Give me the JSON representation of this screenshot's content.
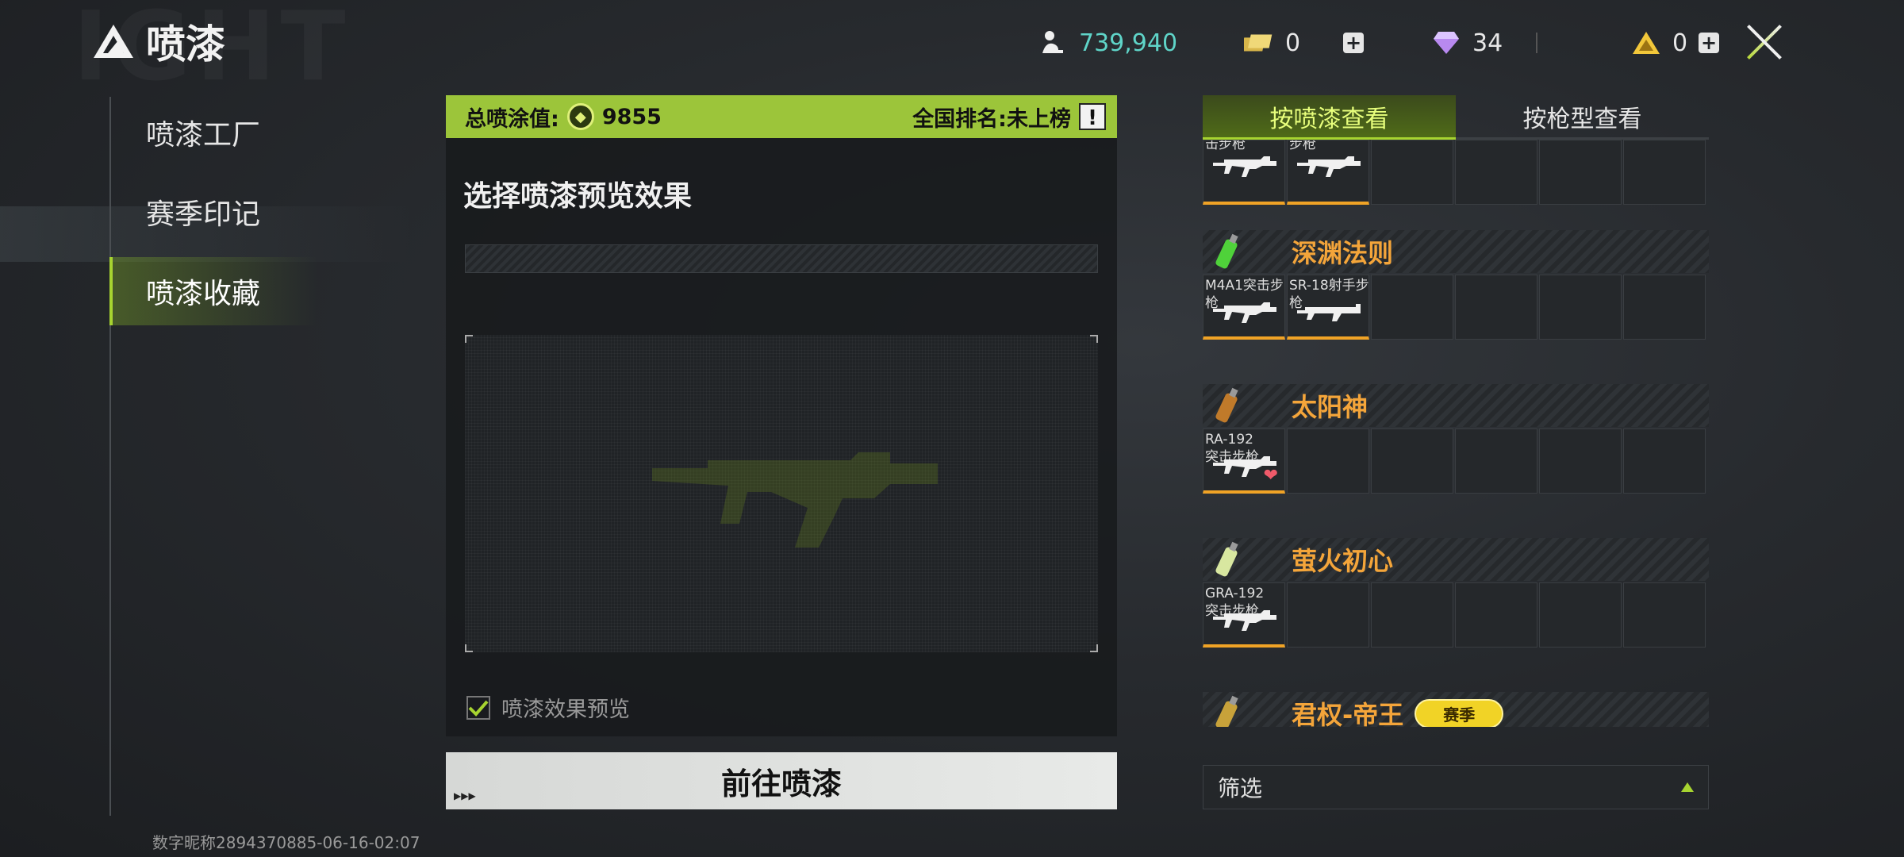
{
  "header": {
    "title": "喷漆",
    "watermark": "IGHT",
    "coins": "739,940",
    "tickets": "0",
    "diamonds": "34",
    "tokens": "0",
    "plus": "+"
  },
  "nav": {
    "items": [
      {
        "label": "喷漆工厂"
      },
      {
        "label": "赛季印记"
      },
      {
        "label": "喷漆收藏"
      }
    ],
    "active_index": 2
  },
  "center": {
    "score_label": "总喷涂值:",
    "score_value": "9855",
    "rank_label": "全国排名:未上榜",
    "info_glyph": "!",
    "preview_title": "选择喷漆预览效果",
    "checkbox_label": "喷漆效果预览",
    "checkbox_checked": true,
    "goto_button": "前往喷漆"
  },
  "right": {
    "tabs": [
      {
        "label": "按喷漆查看",
        "active": true
      },
      {
        "label": "按枪型查看",
        "active": false
      }
    ],
    "top_row_cells": [
      "击步枪",
      "步枪"
    ],
    "groups": [
      {
        "name": "深渊法则",
        "cells": [
          "M4A1突击步枪",
          "SR-18射手步枪"
        ],
        "can_color": "#4fd23a"
      },
      {
        "name": "太阳神",
        "cells": [
          "RA-192\n突击步枪"
        ],
        "can_color": "#c07a2a",
        "favorite": true
      },
      {
        "name": "萤火初心",
        "cells": [
          "GRA-192\n突击步枪"
        ],
        "can_color": "#d8e7a0"
      },
      {
        "name": "君权-帝王",
        "badge": "赛季",
        "can_color": "#c8a23a"
      }
    ],
    "filter_label": "筛选"
  },
  "footer": {
    "user_id": "数字昵称2894370885-06-16-02:07"
  },
  "colors": {
    "accent_green": "#9cc53a",
    "orange": "#f4a53a",
    "teal": "#5fd4c8"
  }
}
